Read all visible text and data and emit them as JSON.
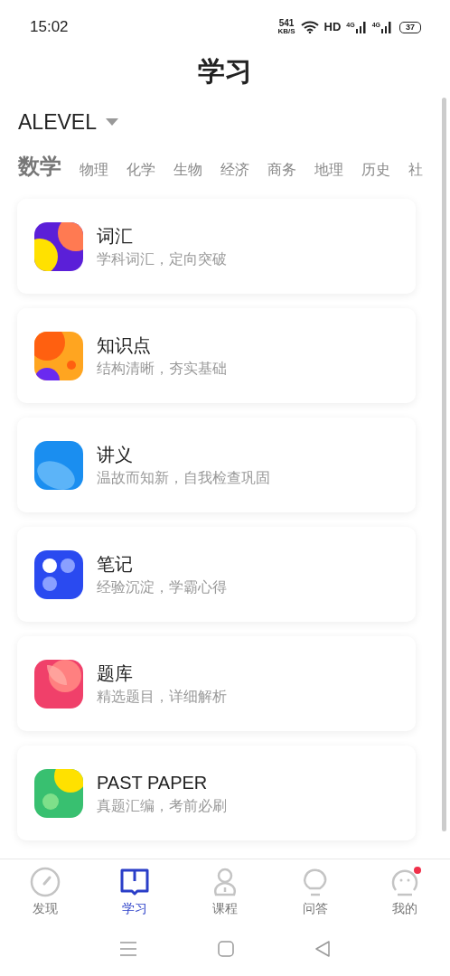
{
  "status_bar": {
    "time": "15:02",
    "speed": "541",
    "speed_unit": "KB/S",
    "hd": "HD",
    "networks": [
      "4G",
      "4G"
    ],
    "battery": "37"
  },
  "title": "学习",
  "exam_selector": {
    "label": "ALEVEL"
  },
  "subject_tabs": [
    {
      "label": "数学",
      "selected": true
    },
    {
      "label": "物理",
      "selected": false
    },
    {
      "label": "化学",
      "selected": false
    },
    {
      "label": "生物",
      "selected": false
    },
    {
      "label": "经济",
      "selected": false
    },
    {
      "label": "商务",
      "selected": false
    },
    {
      "label": "地理",
      "selected": false
    },
    {
      "label": "历史",
      "selected": false
    },
    {
      "label": "社",
      "selected": false
    }
  ],
  "modules": [
    {
      "title": "词汇",
      "subtitle": "学科词汇，定向突破"
    },
    {
      "title": "知识点",
      "subtitle": "结构清晰，夯实基础"
    },
    {
      "title": "讲义",
      "subtitle": "温故而知新，自我检查巩固"
    },
    {
      "title": "笔记",
      "subtitle": "经验沉淀，学霸心得"
    },
    {
      "title": "题库",
      "subtitle": "精选题目，详细解析"
    },
    {
      "title": "PAST PAPER",
      "subtitle": "真题汇编，考前必刷"
    }
  ],
  "bottom_nav": [
    {
      "label": "发现",
      "selected": false,
      "badge": false
    },
    {
      "label": "学习",
      "selected": true,
      "badge": false
    },
    {
      "label": "课程",
      "selected": false,
      "badge": false
    },
    {
      "label": "问答",
      "selected": false,
      "badge": false
    },
    {
      "label": "我的",
      "selected": false,
      "badge": true
    }
  ]
}
